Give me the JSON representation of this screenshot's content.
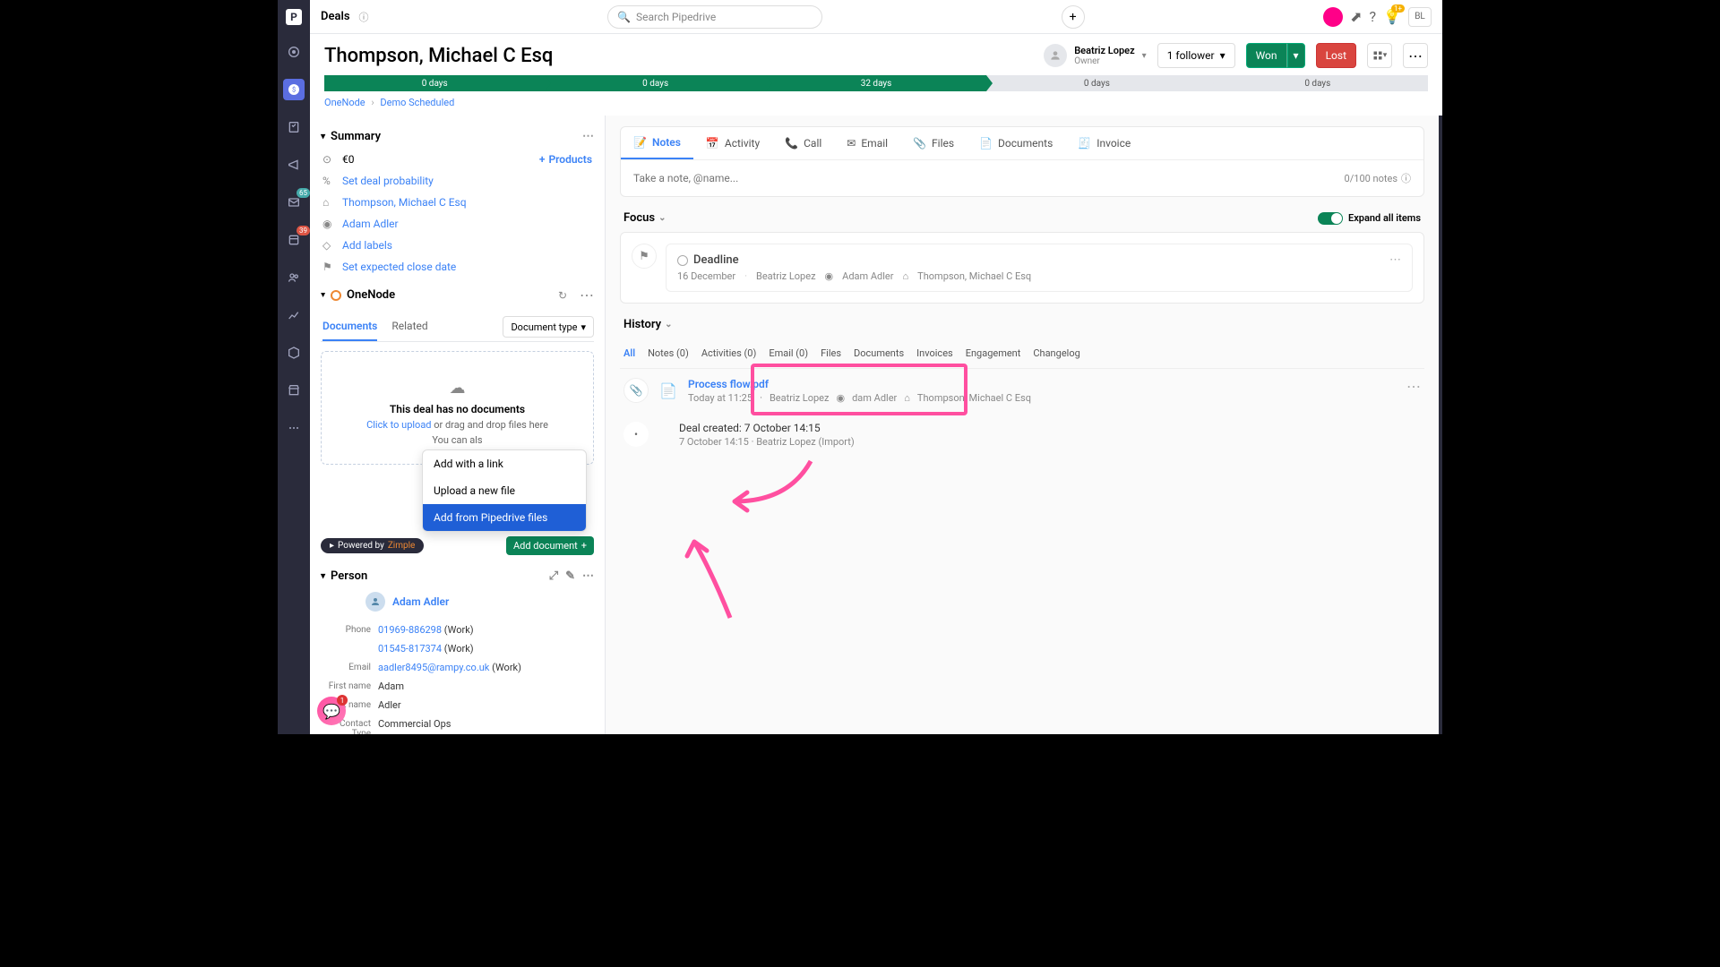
{
  "topbar": {
    "section": "Deals",
    "search_placeholder": "Search Pipedrive",
    "user_initials": "BL",
    "bell_badge": "1+"
  },
  "rail": {
    "mail_badge": "65",
    "contacts_badge": "39"
  },
  "header": {
    "title": "Thompson, Michael C Esq",
    "owner_name": "Beatriz Lopez",
    "owner_role": "Owner",
    "follower_label": "1 follower",
    "won_label": "Won",
    "lost_label": "Lost"
  },
  "pipeline": [
    "0 days",
    "0 days",
    "32 days",
    "0 days",
    "0 days"
  ],
  "breadcrumb": {
    "a": "OneNode",
    "b": "Demo Scheduled"
  },
  "summary": {
    "title": "Summary",
    "value": "€0",
    "products_label": "Products",
    "probability": "Set deal probability",
    "org": "Thompson, Michael C Esq",
    "person": "Adam Adler",
    "labels": "Add labels",
    "close_date": "Set expected close date"
  },
  "onenode": {
    "title": "OneNode",
    "tab_docs": "Documents",
    "tab_related": "Related",
    "doctype": "Document type",
    "empty_title": "This deal has no documents",
    "upload_link": "Click to upload",
    "upload_rest": " or drag and drop files here",
    "also": "You can als",
    "menu": {
      "link": "Add with a link",
      "upload": "Upload a new file",
      "pipedrive": "Add from Pipedrive files"
    },
    "powered": "Powered by ",
    "zimple": "Zimple",
    "add_doc": "Add document"
  },
  "person_panel": {
    "title": "Person",
    "name": "Adam Adler",
    "phone_lbl": "Phone",
    "phone1": "01969-886298",
    "phone1_type": " (Work)",
    "phone2": "01545-817374",
    "phone2_type": " (Work)",
    "email_lbl": "Email",
    "email": "aadler8495@rampy.co.uk",
    "email_type": " (Work)",
    "first_lbl": "First name",
    "first": "Adam",
    "last_lbl": "Last name",
    "last": "Adler",
    "ctype_lbl": "Contact Type",
    "ctype": "Commercial Ops"
  },
  "right": {
    "tabs": {
      "notes": "Notes",
      "activity": "Activity",
      "call": "Call",
      "email": "Email",
      "files": "Files",
      "documents": "Documents",
      "invoice": "Invoice"
    },
    "note_placeholder": "Take a note, @name...",
    "note_count": "0/100 notes",
    "focus": "Focus",
    "expand": "Expand all items",
    "deadline": {
      "title": "Deadline",
      "date": "16 December",
      "owner": "Beatriz Lopez",
      "person": "Adam Adler",
      "org": "Thompson, Michael C Esq"
    },
    "history": "History",
    "htabs": {
      "all": "All",
      "notes": "Notes (0)",
      "activities": "Activities (0)",
      "email": "Email (0)",
      "files": "Files",
      "documents": "Documents",
      "invoices": "Invoices",
      "engagement": "Engagement",
      "changelog": "Changelog"
    },
    "file_item": {
      "name": "Process flow.pdf",
      "time": "Today at 11:25",
      "owner": "Beatriz Lopez",
      "person": "dam Adler",
      "org": "Thompson, Michael C Esq"
    },
    "created_item": {
      "title": "Deal created: 7 October 14:15",
      "meta": "7 October 14:15 · Beatriz Lopez (Import)"
    }
  },
  "chat_badge": "1"
}
